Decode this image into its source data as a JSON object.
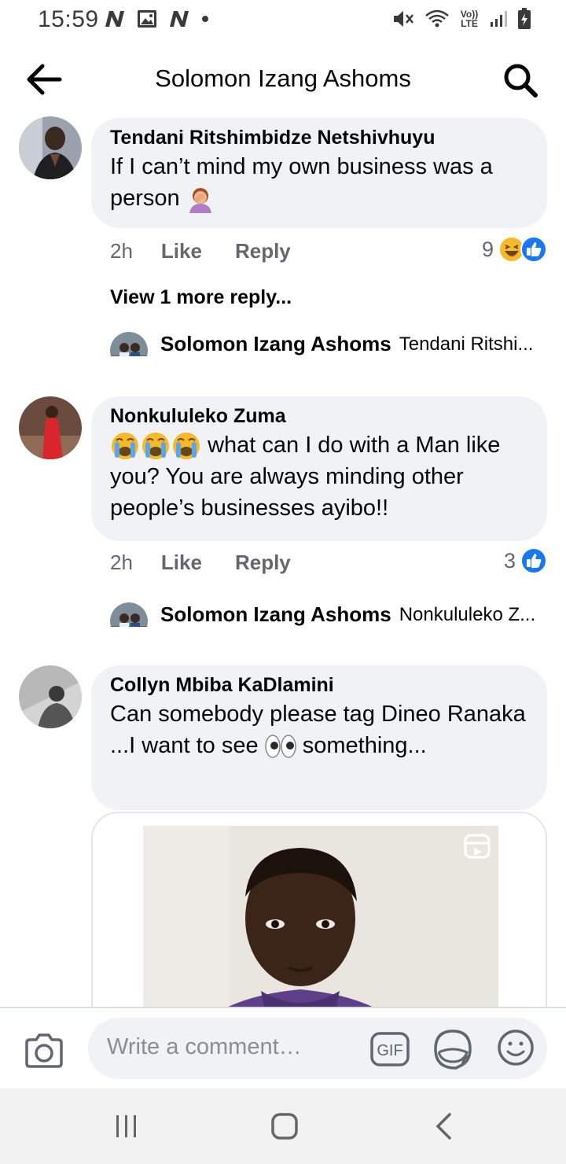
{
  "status_bar": {
    "time": "15:59",
    "network": "Vo)) LTE"
  },
  "header": {
    "title": "Solomon Izang Ashoms"
  },
  "comments": [
    {
      "author": "Tendani Ritshimbidze Netshivhuyu",
      "text": "If I can’t mind my own business was a person",
      "emoji": "person-facepalming",
      "time": "2h",
      "like_label": "Like",
      "reply_label": "Reply",
      "reaction_count": "9",
      "reactions": [
        "haha",
        "like"
      ],
      "view_more": "View 1 more reply...",
      "reply_preview": {
        "author": "Solomon Izang Ashoms",
        "text": "Tendani Ritshi..."
      }
    },
    {
      "author": "Nonkululeko Zuma",
      "emoji": "loudly-crying-face x3",
      "text": "what can I do with a Man like you? You are always minding other people’s businesses ayibo!!",
      "time": "2h",
      "like_label": "Like",
      "reply_label": "Reply",
      "reaction_count": "3",
      "reactions": [
        "like"
      ],
      "reply_preview": {
        "author": "Solomon Izang Ashoms",
        "text": "Nonkululeko Z..."
      }
    },
    {
      "author": "Collyn Mbiba KaDlamini",
      "text_before": "Can somebody please tag Dineo Ranaka ...I want to see",
      "emoji": "eyes",
      "text_after": "something...",
      "attachment": "reel-video-thumbnail"
    }
  ],
  "composer": {
    "placeholder": "Write a comment…"
  },
  "colors": {
    "bubble": "#f0f2f5",
    "meta_text": "#65676b",
    "like_blue": "#1877f2",
    "haha_yellow": "#f7b928"
  }
}
